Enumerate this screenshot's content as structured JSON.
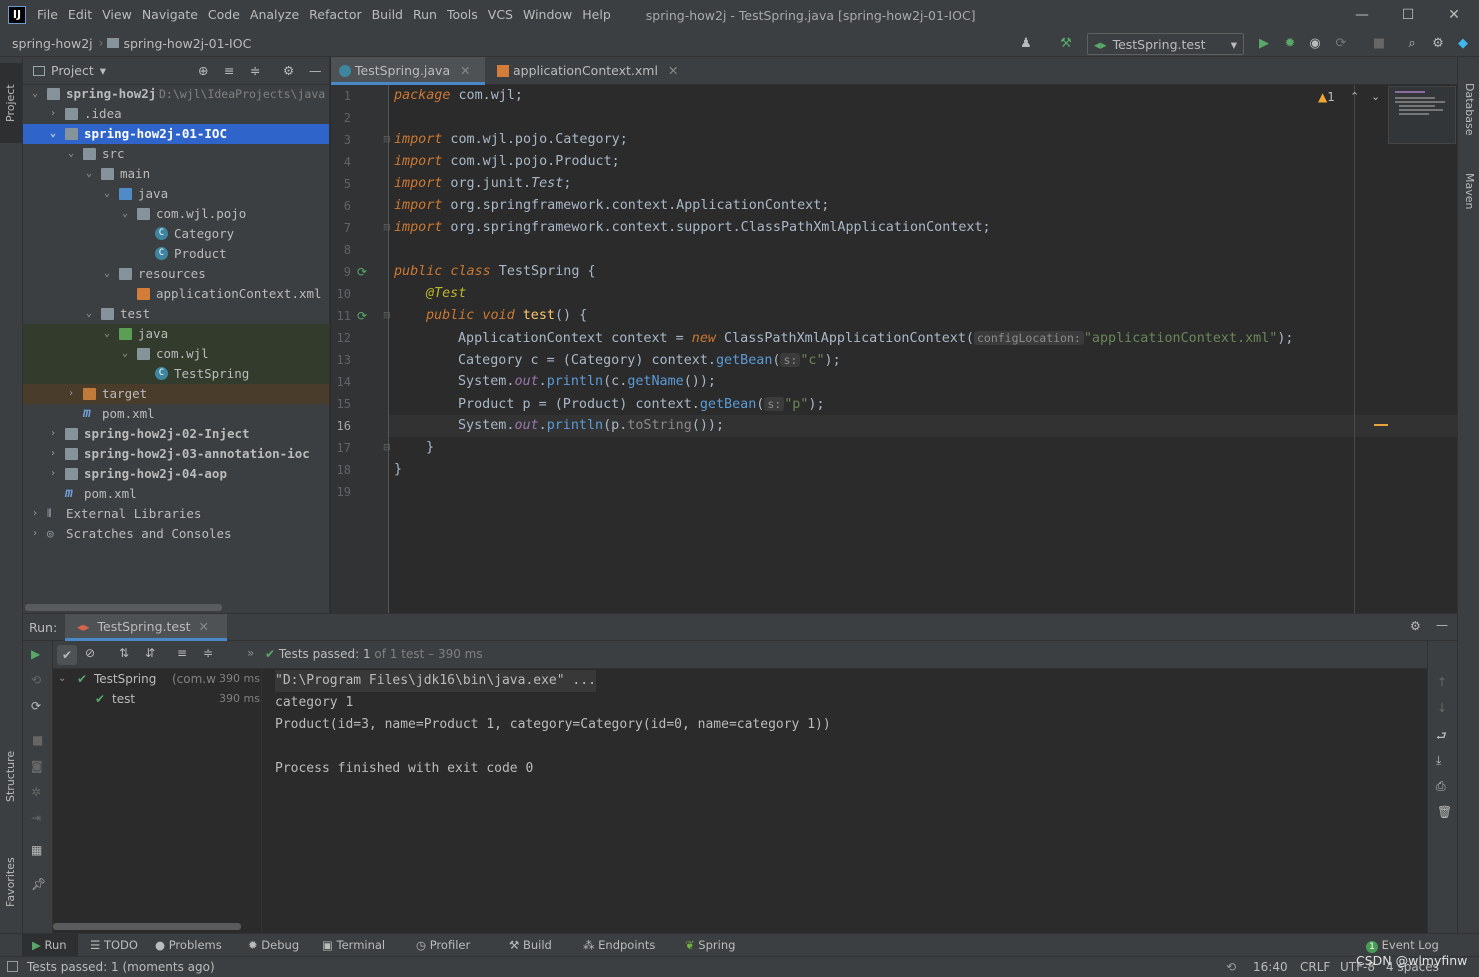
{
  "window": {
    "title": "spring-how2j - TestSpring.java [spring-how2j-01-IOC]",
    "menu": [
      "File",
      "Edit",
      "View",
      "Navigate",
      "Code",
      "Analyze",
      "Refactor",
      "Build",
      "Run",
      "Tools",
      "VCS",
      "Window",
      "Help"
    ]
  },
  "navbar": {
    "crumbs": [
      "spring-how2j",
      "spring-how2j-01-IOC"
    ],
    "run_config": "TestSpring.test"
  },
  "left_strip": {
    "project": "Project",
    "structure": "Structure",
    "favorites": "Favorites"
  },
  "right_strip": {
    "database": "Database",
    "maven": "Maven"
  },
  "project_panel": {
    "title": "Project",
    "tree": [
      {
        "label": "spring-how2j",
        "extra": "D:\\wjl\\IdeaProjects\\java"
      },
      {
        "label": ".idea"
      },
      {
        "label": "spring-how2j-01-IOC"
      },
      {
        "label": "src"
      },
      {
        "label": "main"
      },
      {
        "label": "java"
      },
      {
        "label": "com.wjl.pojo"
      },
      {
        "label": "Category"
      },
      {
        "label": "Product"
      },
      {
        "label": "resources"
      },
      {
        "label": "applicationContext.xml"
      },
      {
        "label": "test"
      },
      {
        "label": "java"
      },
      {
        "label": "com.wjl"
      },
      {
        "label": "TestSpring"
      },
      {
        "label": "target"
      },
      {
        "label": "pom.xml"
      },
      {
        "label": "spring-how2j-02-Inject"
      },
      {
        "label": "spring-how2j-03-annotation-ioc"
      },
      {
        "label": "spring-how2j-04-aop"
      },
      {
        "label": "pom.xml"
      },
      {
        "label": "External Libraries"
      },
      {
        "label": "Scratches and Consoles"
      }
    ]
  },
  "editor": {
    "tabs": [
      "TestSpring.java",
      "applicationContext.xml"
    ],
    "warnings": "1",
    "line_numbers": [
      "1",
      "2",
      "3",
      "4",
      "5",
      "6",
      "7",
      "8",
      "9",
      "10",
      "11",
      "12",
      "13",
      "14",
      "15",
      "16",
      "17",
      "18",
      "19"
    ],
    "code": {
      "l1_kw": "package",
      "l1_rest": " com.wjl;",
      "imp": "import",
      "l3": " com.wjl.pojo.Category;",
      "l4": " com.wjl.pojo.Product;",
      "l5a": " org.junit.",
      "l5b": "Test",
      "l5c": ";",
      "l6": " org.springframework.context.ApplicationContext;",
      "l7": " org.springframework.context.support.ClassPathXmlApplicationContext;",
      "l9_kw": "public class",
      "l9_rest": " TestSpring {",
      "l10": "@Test",
      "l11_kw": "public void",
      "l11_m": "test",
      "l11_rest": "() {",
      "l12a": "ApplicationContext context = ",
      "l12_new": "new",
      "l12b": " ClassPathXmlApplicationContext(",
      "l12_hint": "configLocation:",
      "l12_str": "\"applicationContext.xml\"",
      "l12c": ");",
      "l13a": "Category c = (Category) context.",
      "l13_m": "getBean",
      "l13b": "(",
      "l13_hint": "s:",
      "l13_str": "\"c\"",
      "l13c": ");",
      "l14a": "System.",
      "l14_f": "out",
      "l14b": ".",
      "l14_m": "println",
      "l14c": "(c.",
      "l14_m2": "getName",
      "l14d": "());",
      "l15a": "Product p = (Product) context.",
      "l15_m": "getBean",
      "l15b": "(",
      "l15_hint": "s:",
      "l15_str": "\"p\"",
      "l15c": ");",
      "l16a": "System.",
      "l16_f": "out",
      "l16b": ".",
      "l16_m": "println",
      "l16c": "(p.",
      "l16_m2": "toString",
      "l16d": "());",
      "l17": "}",
      "l18": "}"
    }
  },
  "run_panel": {
    "label": "Run:",
    "tab": "TestSpring.test",
    "status": {
      "prefix": "Tests passed:",
      "count": "1",
      "of": "of 1 test",
      "time": "390 ms"
    },
    "tests": [
      {
        "name": "TestSpring",
        "pkg": "(com.w",
        "time": "390 ms"
      },
      {
        "name": "test",
        "time": "390 ms"
      }
    ],
    "console": [
      "\"D:\\Program Files\\jdk16\\bin\\java.exe\" ...",
      "category 1",
      "Product(id=3, name=Product 1, category=Category(id=0, name=category 1))",
      "",
      "Process finished with exit code 0"
    ]
  },
  "tool_strip": [
    "Run",
    "TODO",
    "Problems",
    "Debug",
    "Terminal",
    "Profiler",
    "Build",
    "Endpoints",
    "Spring"
  ],
  "event_log": {
    "count": "1",
    "label": "Event Log"
  },
  "status_bar": {
    "message": "Tests passed: 1 (moments ago)",
    "position": "16:40",
    "line_sep": "CRLF",
    "encoding": "UTF-8",
    "indent": "4 spaces",
    "watermark": "CSDN @wlmyfinw"
  },
  "colors": {
    "accent": "#4a88c7",
    "green": "#59a869",
    "keyword": "#cc7832",
    "string": "#6a8759",
    "method": "#ffc66d",
    "field": "#9876aa",
    "annotation": "#bbb529"
  }
}
